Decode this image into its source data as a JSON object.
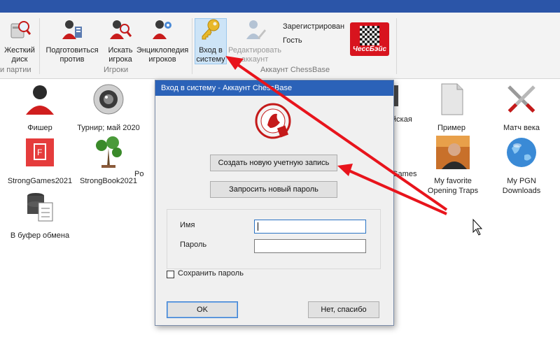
{
  "ribbon": {
    "buttons": {
      "hard_disk": "Жесткий\nдиск",
      "prepare": "Подготовиться\nпротив",
      "search_players": "Искать\nигрока",
      "encyclopedia": "Энциклопедия\nигроков",
      "login": "Вход в\nсистему",
      "edit_account": "Редактировать\nаккаунт"
    },
    "groups": {
      "parties": "и партии",
      "players": "Игроки",
      "account": "Аккаунт ChessBase"
    },
    "account_status": "Зарегистрирован",
    "account_user": "Гость",
    "logo_text": "ЧессБэйс"
  },
  "desktop": {
    "tiles": {
      "fischer": "Фишер",
      "tournament": "Турнир; май 2020",
      "primer": "Пример",
      "match": "Матч века",
      "stronggames": "StrongGames2021",
      "strongbook": "StrongBook2021",
      "po": "Po",
      "games_partial": "Games",
      "opening_traps": "My favorite\nOpening Traps",
      "pgn_downloads": "My PGN\nDownloads",
      "clipboard": "В буфер обмена",
      "kaya_partial": "йская"
    }
  },
  "dialog": {
    "title": "Вход в систему - Аккаунт ChessBase",
    "create_account": "Создать новую учетную запись",
    "request_password": "Запросить новый пароль",
    "name_label": "Имя",
    "password_label": "Пароль",
    "name_value": "",
    "password_value": "",
    "save_password": "Сохранить пароль",
    "save_password_checked": false,
    "ok": "OK",
    "no_thanks": "Нет, спасибо"
  },
  "colors": {
    "title_bar": "#2b62b8",
    "annotation_arrow": "#e8141c",
    "chessbase_red": "#d8141e"
  }
}
